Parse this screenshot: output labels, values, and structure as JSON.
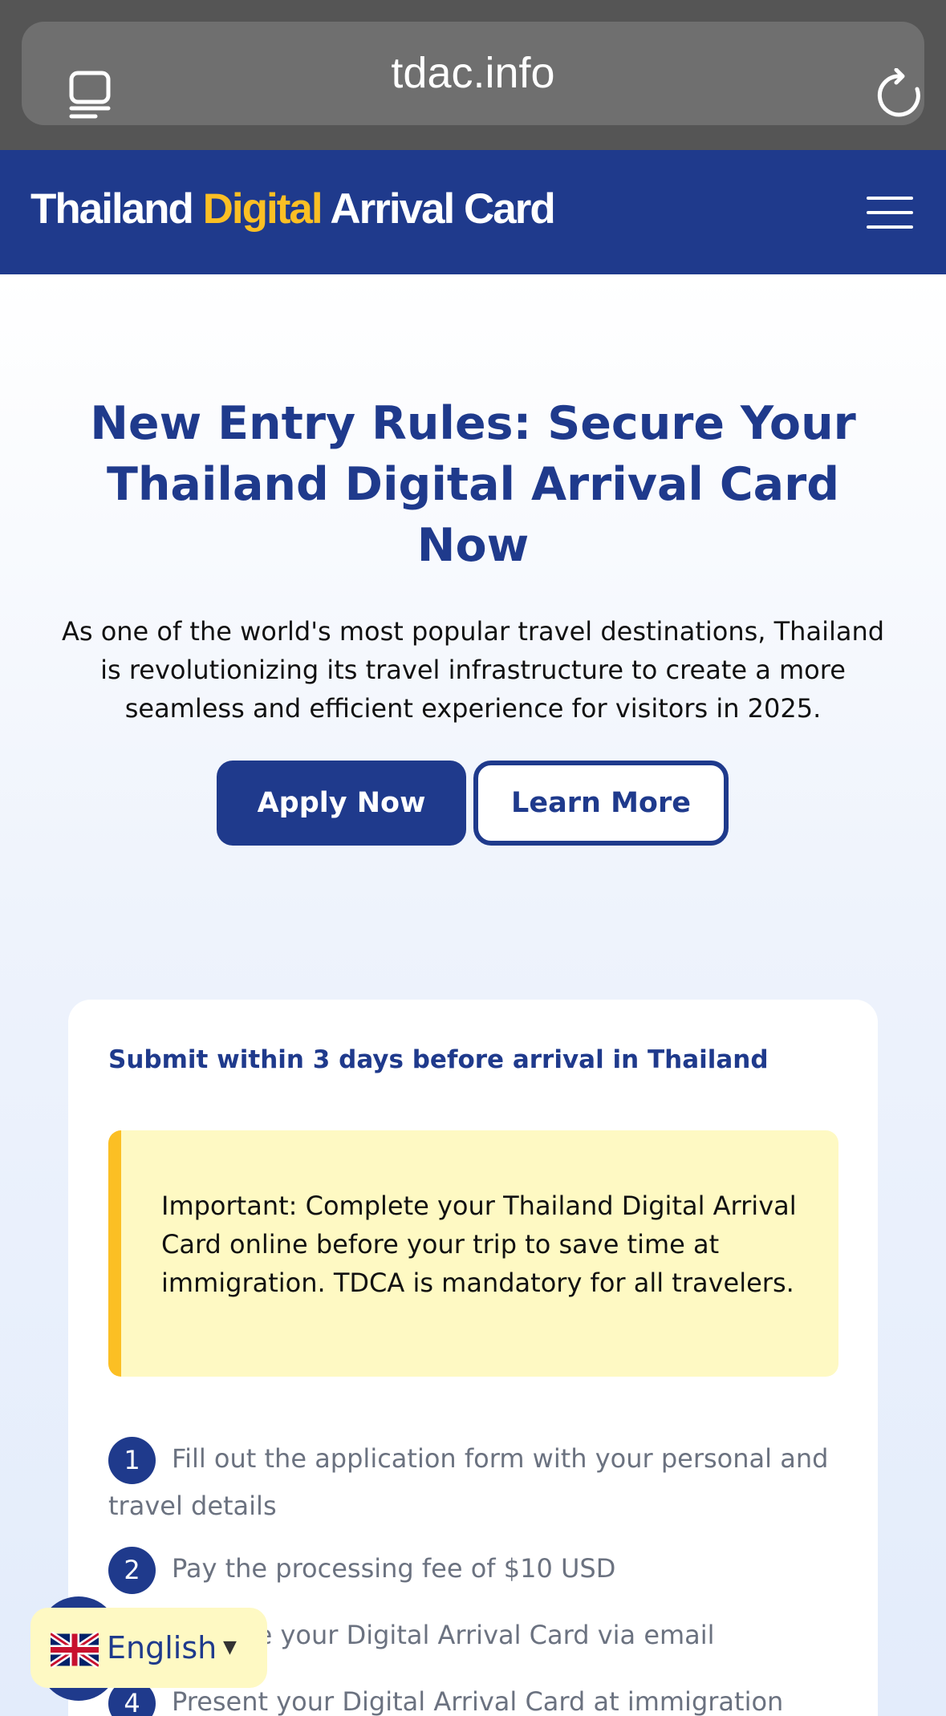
{
  "browser": {
    "url": "tdac.info"
  },
  "header": {
    "brand_part1": "Thailand ",
    "brand_accent": "Digital",
    "brand_part2": " Arrival Card"
  },
  "hero": {
    "title": "New Entry Rules: Secure Your Thailand Digital Arrival Card Now",
    "description": "As one of the world's most popular travel destinations, Thailand is revolutionizing its travel infrastructure to create a more seamless and efficient experience for visitors in 2025.",
    "apply_label": "Apply Now",
    "learn_label": "Learn More"
  },
  "card": {
    "subtitle": "Submit within 3 days before arrival in Thailand",
    "notice": "Important: Complete your Thailand Digital Arrival Card online before your trip to save time at immigration. TDCA is mandatory for all travelers.",
    "steps": [
      {
        "num": "1",
        "text": "Fill out the application form with your personal and travel details"
      },
      {
        "num": "2",
        "text": "Pay the processing fee of $10 USD"
      },
      {
        "num": "3",
        "text": "Receive your Digital Arrival Card via email"
      },
      {
        "num": "4",
        "text": "Present your Digital Arrival Card at immigration"
      }
    ]
  },
  "language": {
    "label": "English",
    "caret": "▼"
  },
  "colors": {
    "brand_blue": "#1f3a8c",
    "accent_yellow": "#fbbf24",
    "notice_bg": "#fef9c3"
  },
  "icons": [
    "tabs-icon",
    "reload-icon",
    "menu-icon",
    "uk-flag-icon"
  ]
}
